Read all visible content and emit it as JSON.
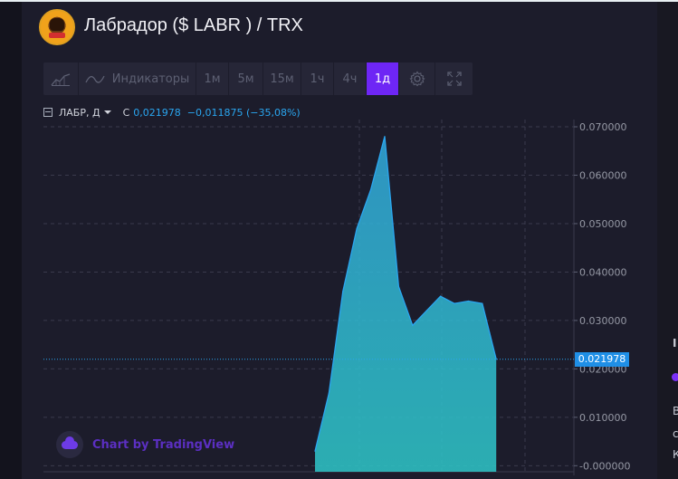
{
  "header": {
    "title": "Лабрадор ($ LABR ) / TRX"
  },
  "toolbar": {
    "indicators_label": "Индикаторы",
    "intervals": [
      "1м",
      "5м",
      "15м",
      "1ч",
      "4ч",
      "1д"
    ],
    "active_interval": "1д",
    "icons": [
      "chart-type-icon",
      "indicators-icon",
      "gear-icon",
      "fullscreen-icon"
    ]
  },
  "legend": {
    "symbol": "ЛАБР, Д",
    "close_label": "С",
    "close_value": "0,021978",
    "change": "−0,011875 (−35,08%)"
  },
  "price_tag": "0.021978",
  "watermark": "Chart by TradingView",
  "right_panel": {
    "letters": [
      "I",
      "В",
      "с",
      "К"
    ]
  },
  "colors": {
    "accent": "#6e26f5",
    "line": "#2aa6f0",
    "price_tag": "#1f8fe6"
  },
  "chart_data": {
    "type": "area",
    "x": [
      1,
      2,
      3,
      4,
      5,
      6,
      7,
      8,
      9,
      10,
      11,
      12,
      13,
      14
    ],
    "values": [
      0.003,
      0.015,
      0.036,
      0.049,
      0.057,
      0.068,
      0.037,
      0.029,
      0.032,
      0.035,
      0.0335,
      0.034,
      0.0335,
      0.021978
    ],
    "ylim": [
      -0.0005,
      0.0715
    ],
    "y_ticks": [
      0.0,
      0.01,
      0.02,
      0.03,
      0.04,
      0.05,
      0.06,
      0.07
    ],
    "y_tick_labels": [
      "0.000000",
      "0.010000",
      "0.020000",
      "0.030000",
      "0.040000",
      "0.050000",
      "0.060000",
      "0.070000"
    ],
    "last_value": 0.021978,
    "grid": true,
    "legend_position": "top-left"
  }
}
